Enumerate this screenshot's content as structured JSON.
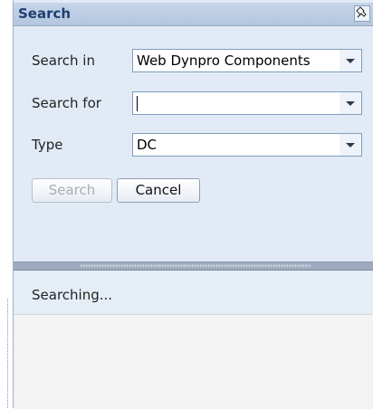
{
  "panel": {
    "title": "Search",
    "pin_icon": "pin-icon"
  },
  "form": {
    "search_in": {
      "label": "Search in",
      "value": "Web Dynpro Components"
    },
    "search_for": {
      "label": "Search for",
      "value": ""
    },
    "type": {
      "label": "Type",
      "value": "DC"
    }
  },
  "buttons": {
    "search": "Search",
    "cancel": "Cancel"
  },
  "status": {
    "text": "Searching..."
  },
  "colors": {
    "panel_bg": "#e2ebf5",
    "title_text": "#1f3f6f",
    "splitter": "#9eabbe"
  }
}
